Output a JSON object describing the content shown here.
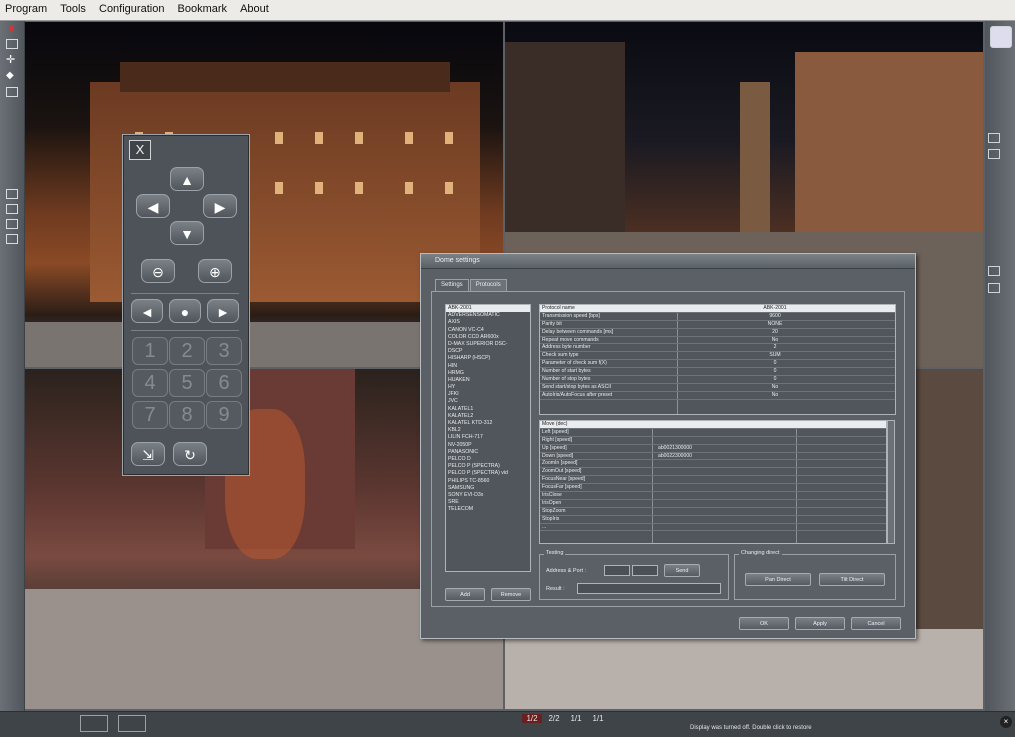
{
  "menu": [
    "Program",
    "Tools",
    "Configuration",
    "Bookmark",
    "About"
  ],
  "ptz": {
    "close": "X",
    "numbers": [
      "1",
      "2",
      "3",
      "4",
      "5",
      "6",
      "7",
      "8",
      "9"
    ]
  },
  "dialog": {
    "title": "Dome settings",
    "tabs": [
      "Settings",
      "Protocols"
    ],
    "protocols": [
      "ABK-2001",
      "ADVERSENSOMATIC",
      "AXIS",
      "CANON VC-C4",
      "COLOR CCD AR600x",
      "D-MAX SUPERIOR DSC-",
      "DSCP",
      "HISHARP (HSCP)",
      "HIN",
      "HRMG",
      "HUAKEN",
      "HY",
      "JFKI",
      "JVC",
      "KALATEL1",
      "KALATEL2",
      "KALATEL KTD-312",
      "KBL2",
      "LILIN FCH-717",
      "NV-2050P",
      "PANASONIC",
      "PELCO D",
      "PELCO P (SPECTRA)",
      "PELCO P (SPECTRA) vid",
      "PHILIPS TC-8560",
      "SAMSUNG",
      "SONY EVI-D3x",
      "SRE",
      "TELECOM"
    ],
    "selected_protocol": "ABK-2001",
    "params": [
      {
        "k": "Protocol name",
        "v": "ABK-2001"
      },
      {
        "k": "Transmission speed [bps]",
        "v": "9600"
      },
      {
        "k": "Parity bit",
        "v": "NONE"
      },
      {
        "k": "Delay between commands [ms]",
        "v": "20"
      },
      {
        "k": "Repeat move commands",
        "v": "No"
      },
      {
        "k": "Address byte number",
        "v": "2"
      },
      {
        "k": "Check sum type",
        "v": "SUM"
      },
      {
        "k": "Parameter of check sum f(X)",
        "v": "0"
      },
      {
        "k": "Number of start bytes",
        "v": "0"
      },
      {
        "k": "Number of stop bytes",
        "v": "0"
      },
      {
        "k": "Send start/stop bytes as ASCII",
        "v": "No"
      },
      {
        "k": "AutoIris/AutoFocus after preset",
        "v": "No"
      }
    ],
    "commands": [
      {
        "k": "Move (dec)",
        "v": ""
      },
      {
        "k": "Left [speed]",
        "v": ""
      },
      {
        "k": "Right [speed]",
        "v": ""
      },
      {
        "k": "Up [speed]",
        "v": "ab0021300000"
      },
      {
        "k": "Down [speed]",
        "v": "ab0022300000"
      },
      {
        "k": "ZoomIn [speed]",
        "v": ""
      },
      {
        "k": "ZoomOut [speed]",
        "v": ""
      },
      {
        "k": "FocusNear [speed]",
        "v": ""
      },
      {
        "k": "FocusFar [speed]",
        "v": ""
      },
      {
        "k": "IrisClose",
        "v": ""
      },
      {
        "k": "IrisOpen",
        "v": ""
      },
      {
        "k": "StopZoom",
        "v": ""
      },
      {
        "k": "StopIris",
        "v": ""
      },
      {
        "k": "...",
        "v": ""
      }
    ],
    "add": "Add",
    "remove": "Remove",
    "testing": {
      "group": "Testing",
      "address_label": "Address & Port :",
      "send": "Send",
      "result_label": "Result :"
    },
    "direct": {
      "group": "Changing direct",
      "pan": "Pan Direct",
      "tilt": "Tilt Direct"
    },
    "ok": "OK",
    "apply": "Apply",
    "cancel": "Cancel"
  },
  "status": {
    "message": "Display was turned off. Double click to restore",
    "pages": [
      "1/2",
      "2/2",
      "1/1",
      "1/1"
    ]
  }
}
